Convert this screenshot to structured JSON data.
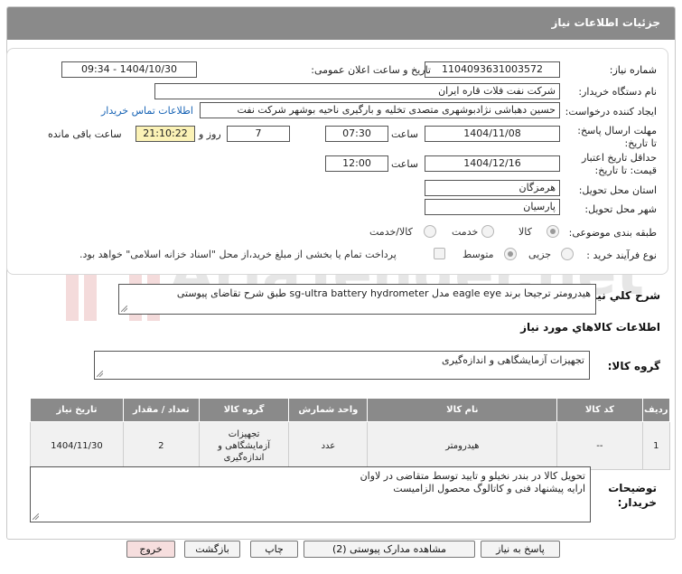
{
  "window_title": "جزئیات اطلاعات نیاز",
  "labels": {
    "need_number": "شماره نیاز:",
    "announce_datetime": "تاریخ و ساعت اعلان عمومی:",
    "buyer_org": "نام دستگاه خریدار:",
    "requester": "ایجاد کننده درخواست:",
    "reply_deadline": "مهلت ارسال پاسخ: تا تاریخ:",
    "time": "ساعت",
    "days_and": "روز و",
    "remaining": "ساعت باقی مانده",
    "price_validity": "حداقل تاریخ اعتبار قیمت: تا تاریخ:",
    "province": "استان محل تحویل:",
    "city": "شهر محل تحویل:",
    "category": "طبقه بندی موضوعی:",
    "process_type": "نوع فرآیند خرید :",
    "summary": "شرح کلي نیاز:",
    "goods_info": "اطلاعات کالاهاي مورد نياز",
    "goods_group": "گروه کالا:",
    "buyer_notes": "توضیحات خریدار:"
  },
  "values": {
    "need_number": "1104093631003572",
    "announce_datetime": "1404/10/30 - 09:34",
    "buyer_org": "شرکت نفت فلات قاره ایران",
    "requester": "حسین دهباشی نژادبوشهری متصدی تخلیه و بارگیری ناحیه بوشهر شرکت نفت",
    "contact_link": "اطلاعات تماس خریدار",
    "reply_date": "1404/11/08",
    "reply_time": "07:30",
    "days": "7",
    "countdown": "21:10:22",
    "validity_date": "1404/12/16",
    "validity_time": "12:00",
    "province": "هرمزگان",
    "city": "پارسیان",
    "summary_text": "هیدرومتر ترجیحا برند eagle eye مدل sg-ultra battery hydrometer طبق شرح تقاضای پیوستی",
    "goods_group_text": "تجهیزات آزمایشگاهی و اندازه‌گیری",
    "notes_line1": "تحویل کالا در بندر نخیلو و تایید توسط متقاضی در لاوان",
    "notes_line2": "ارایه پیشنهاد فنی و کاتالوگ محصول الزامیست"
  },
  "category_options": [
    {
      "label": "کالا",
      "selected": true
    },
    {
      "label": "خدمت",
      "selected": false
    },
    {
      "label": "کالا/خدمت",
      "selected": false
    }
  ],
  "process_options": [
    {
      "label": "جزیی",
      "selected": false
    },
    {
      "label": "متوسط",
      "selected": true
    }
  ],
  "payment_note": "پرداخت تمام یا بخشی از مبلغ خرید،از محل \"اسناد خزانه اسلامی\" خواهد بود.",
  "table": {
    "headers": [
      "ردیف",
      "کد کالا",
      "نام کالا",
      "واحد شمارش",
      "تعداد / مقدار",
      "تاریخ نیاز"
    ],
    "rows": [
      [
        "1",
        "--",
        "هیدرومتر",
        "عدد",
        "2",
        "1404/11/30",
        "تجهیزات آزمایشگاهی و اندازه‌گیری"
      ]
    ],
    "extra_header": "گروه کالا"
  },
  "buttons": {
    "reply": "پاسخ به نیاز",
    "attachments": "مشاهده مدارک پیوستی (2)",
    "print": "چاپ",
    "back": "بازگشت",
    "exit": "خروج"
  },
  "watermark": "AriaTender.net"
}
